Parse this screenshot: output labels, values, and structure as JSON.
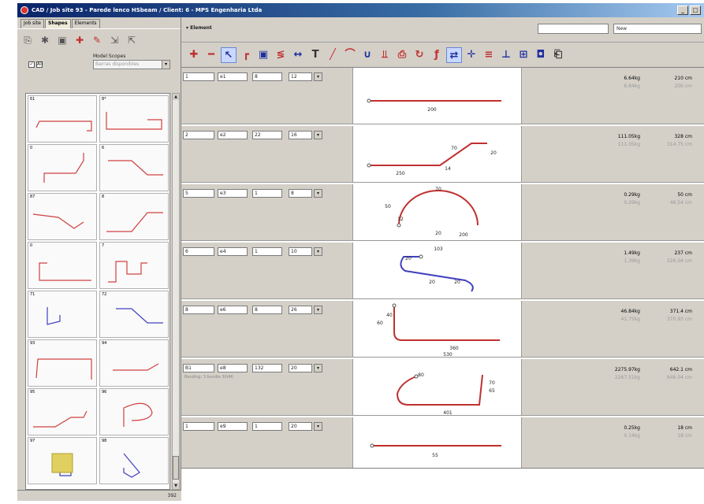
{
  "window": {
    "title": "CAD / Job site 93 - Parede lenco HSbeam / Client: 6 - MPS Engenharia Ltda",
    "minimize": "_",
    "restore": "□"
  },
  "left_panel": {
    "tabs": [
      "Job site",
      "Shapes",
      "Elements"
    ],
    "active_tab": "Shapes",
    "model_label": "Model Scopes",
    "model_select": "Barras disponibles",
    "checkbox_label": "All",
    "footer_count": "392",
    "shape_numbers": [
      "61",
      "8*",
      "0",
      "6",
      "87",
      "8",
      "0",
      "7",
      "71",
      "72",
      "93",
      "94",
      "95",
      "96",
      "97",
      "98"
    ]
  },
  "header": {
    "element_label": "Element",
    "search_value": "",
    "new_label": "New"
  },
  "toolbar": {
    "icons": [
      "add-icon",
      "remove-icon",
      "pointer-icon",
      "corner-icon",
      "box-icon",
      "spring-icon",
      "dimension-icon",
      "text-icon",
      "line-icon",
      "arc-icon",
      "hook-icon",
      "rebar-icon",
      "print-icon",
      "refresh-icon",
      "function-icon",
      "mirror-icon",
      "snap-icon",
      "stack-icon",
      "measure-icon",
      "table-icon",
      "save-icon",
      "clipboard-icon"
    ]
  },
  "rows": [
    {
      "f1": "1",
      "f2": "e1",
      "f3": "8",
      "f4": "12",
      "labels": [
        "200"
      ],
      "w1": "6.64kg",
      "w2": "210 cm",
      "w3": "6.64kg",
      "w4": "200 cm",
      "note": ""
    },
    {
      "f1": "2",
      "f2": "e2",
      "f3": "22",
      "f4": "16",
      "labels": [
        "250",
        "70",
        "20",
        "14"
      ],
      "w1": "111.05kg",
      "w2": "328 cm",
      "w3": "111.05kg",
      "w4": "314.75 cm",
      "note": ""
    },
    {
      "f1": "5",
      "f2": "e3",
      "f3": "1",
      "f4": "8",
      "labels": [
        "70",
        "50",
        "20",
        "200",
        "12"
      ],
      "w1": "0.29kg",
      "w2": "50 cm",
      "w3": "0.29kg",
      "w4": "46.54 cm",
      "note": ""
    },
    {
      "f1": "6",
      "f2": "e4",
      "f3": "1",
      "f4": "10",
      "labels": [
        "103",
        "20",
        "20",
        "20"
      ],
      "w1": "1.49kg",
      "w2": "237 cm",
      "w3": "1.39kg",
      "w4": "226.04 cm",
      "note": ""
    },
    {
      "f1": "8",
      "f2": "e6",
      "f3": "8",
      "f4": "26",
      "labels": [
        "40",
        "60",
        "360",
        "530"
      ],
      "w1": "46.84kg",
      "w2": "371.4 cm",
      "w3": "41.75kg",
      "w4": "370.93 cm",
      "note": ""
    },
    {
      "f1": "B1",
      "f2": "e8",
      "f3": "132",
      "f4": "20",
      "labels": [
        "80",
        "70",
        "65",
        "401"
      ],
      "w1": "2275.97kg",
      "w2": "642.1 cm",
      "w3": "2267.51kg",
      "w4": "646.04 cm",
      "note": "Bending: 3 bundle 30/46"
    },
    {
      "f1": "1",
      "f2": "e9",
      "f3": "1",
      "f4": "20",
      "labels": [
        "55"
      ],
      "w1": "0.25kg",
      "w2": "18 cm",
      "w3": "0.14kg",
      "w4": "18 cm",
      "note": ""
    }
  ]
}
